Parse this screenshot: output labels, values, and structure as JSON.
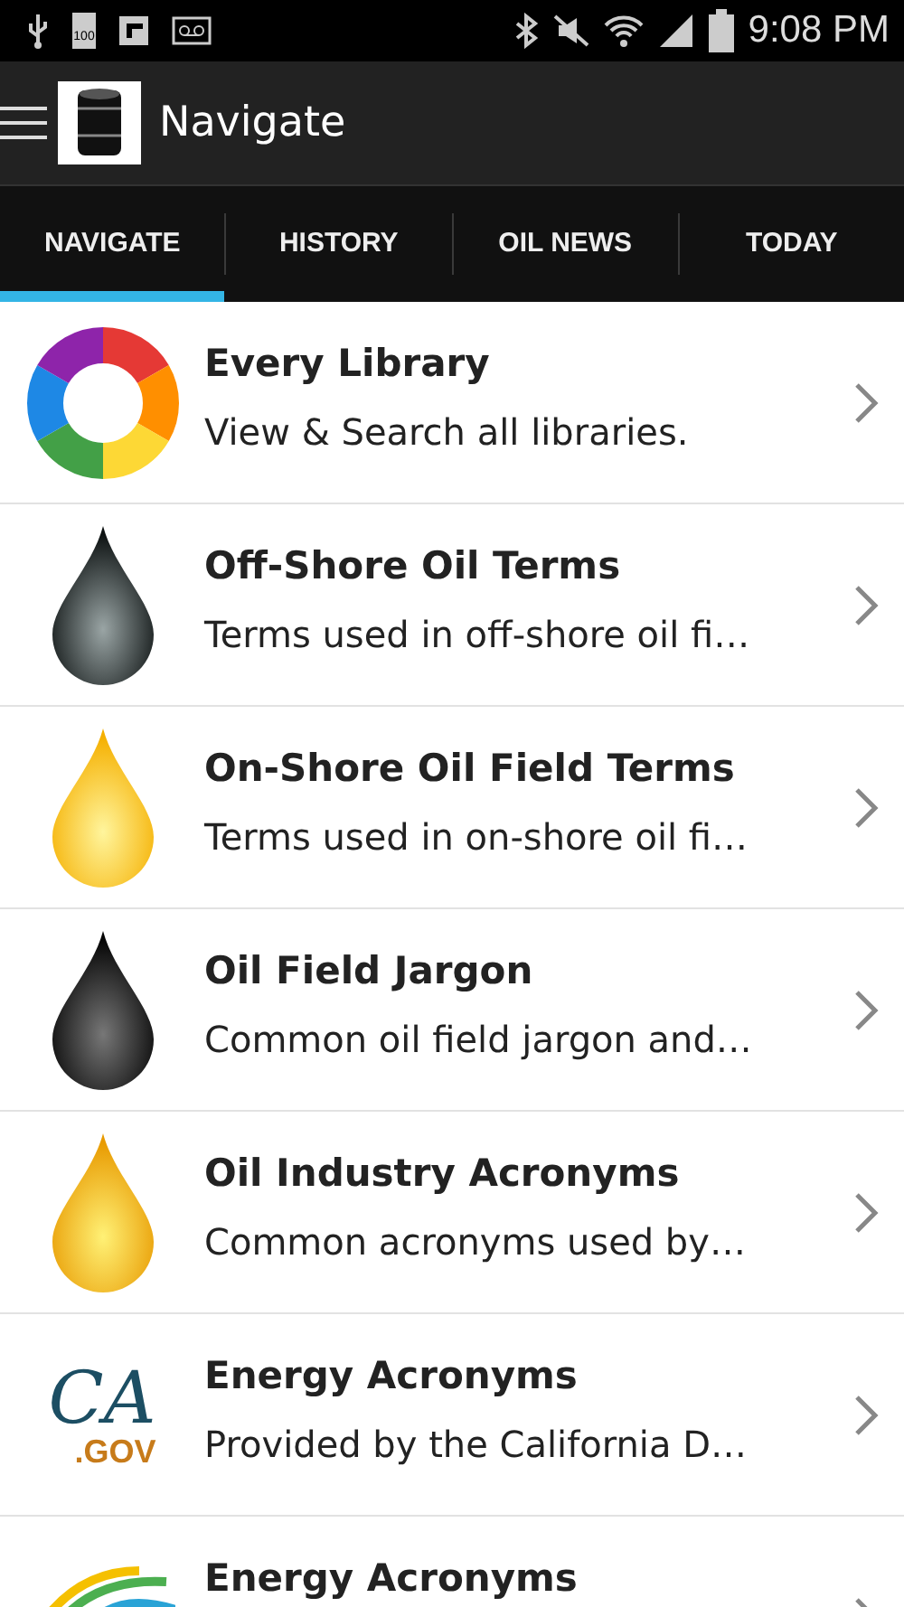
{
  "status_bar": {
    "battery_label": "100",
    "time": "9:08 PM"
  },
  "action_bar": {
    "title": "Navigate"
  },
  "tabs": [
    {
      "label": "NAVIGATE",
      "selected": true
    },
    {
      "label": "HISTORY",
      "selected": false
    },
    {
      "label": "OIL NEWS",
      "selected": false
    },
    {
      "label": "TODAY",
      "selected": false
    }
  ],
  "libraries": [
    {
      "kind": "ring",
      "title": "Every Library",
      "subtitle": "View & Search all libraries."
    },
    {
      "kind": "drop-dark",
      "title": "Off-Shore Oil Terms",
      "subtitle": "Terms used in off-shore oil fi…"
    },
    {
      "kind": "drop-yellow",
      "title": "On-Shore Oil Field Terms",
      "subtitle": "Terms used in on-shore oil fi…"
    },
    {
      "kind": "drop-black",
      "title": "Oil Field Jargon",
      "subtitle": "Common oil field jargon and…"
    },
    {
      "kind": "drop-gold",
      "title": "Oil Industry Acronyms",
      "subtitle": "Common acronyms used by…"
    },
    {
      "kind": "ca-gov",
      "logo_text": "CA",
      "logo_suffix": ".GOV",
      "title": "Energy Acronyms",
      "subtitle": "Provided by the California D…"
    },
    {
      "kind": "swoosh",
      "title": "Energy Acronyms"
    }
  ]
}
